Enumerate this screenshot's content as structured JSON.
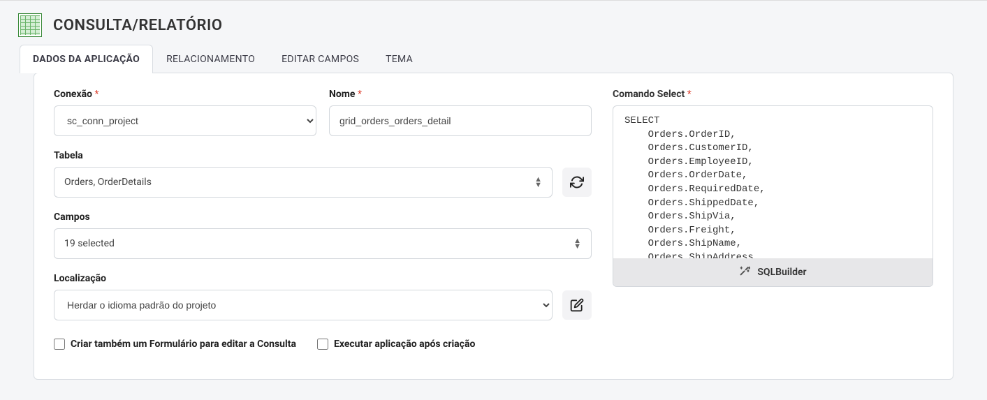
{
  "header": {
    "title": "CONSULTA/RELATÓRIO"
  },
  "tabs": [
    {
      "label": "DADOS DA APLICAÇÃO",
      "active": true
    },
    {
      "label": "RELACIONAMENTO",
      "active": false
    },
    {
      "label": "EDITAR CAMPOS",
      "active": false
    },
    {
      "label": "TEMA",
      "active": false
    }
  ],
  "form": {
    "connection": {
      "label": "Conexão",
      "value": "sc_conn_project"
    },
    "name": {
      "label": "Nome",
      "value": "grid_orders_orders_detail"
    },
    "table": {
      "label": "Tabela",
      "value": "Orders, OrderDetails"
    },
    "fields": {
      "label": "Campos",
      "value": "19 selected"
    },
    "locale": {
      "label": "Localização",
      "value": "Herdar o idioma padrão do projeto"
    },
    "checkbox_create_form": "Criar também um Formulário para editar a Consulta",
    "checkbox_run_after": "Executar aplicação após criação"
  },
  "sql": {
    "label": "Comando Select",
    "builder_label": "SQLBuilder",
    "text": "SELECT \n    Orders.OrderID,\n    Orders.CustomerID,\n    Orders.EmployeeID,\n    Orders.OrderDate,\n    Orders.RequiredDate,\n    Orders.ShippedDate,\n    Orders.ShipVia,\n    Orders.Freight,\n    Orders.ShipName,\n    Orders.ShipAddress,"
  }
}
